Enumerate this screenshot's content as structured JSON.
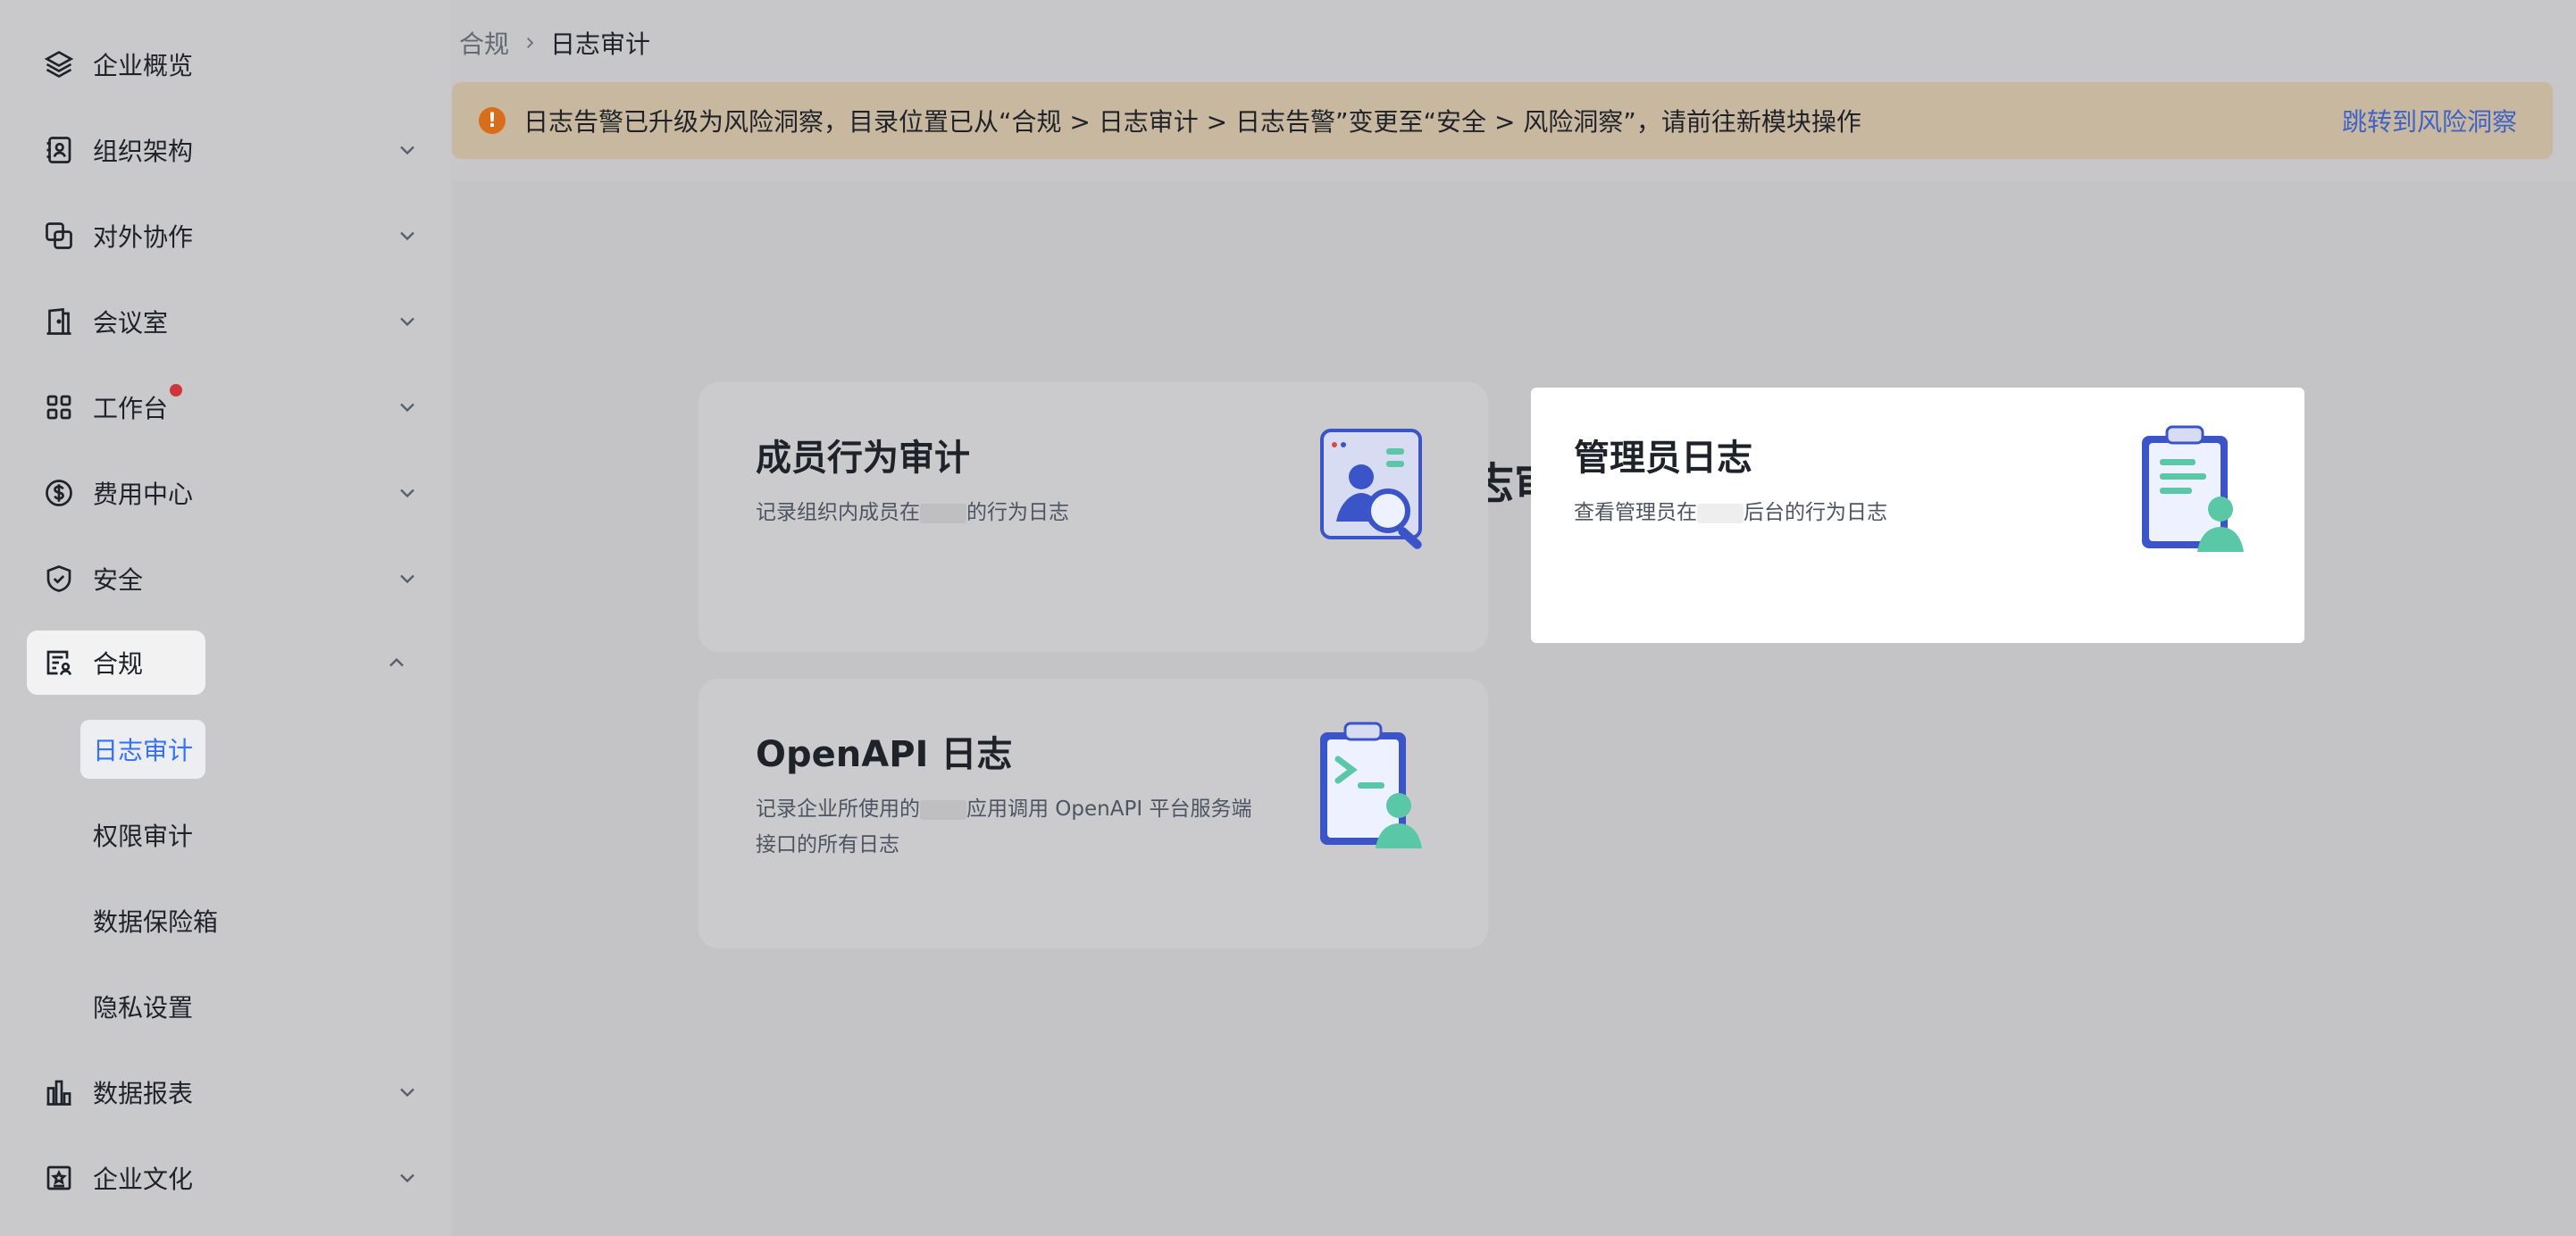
{
  "sidebar": {
    "items": [
      {
        "label": "企业概览",
        "icon": "layers-icon",
        "has_chevron": false
      },
      {
        "label": "组织架构",
        "icon": "contact-book-icon",
        "has_chevron": true
      },
      {
        "label": "对外协作",
        "icon": "link-squares-icon",
        "has_chevron": true
      },
      {
        "label": "会议室",
        "icon": "door-icon",
        "has_chevron": true
      },
      {
        "label": "工作台",
        "icon": "grid-icon",
        "has_chevron": true,
        "badge": true
      },
      {
        "label": "费用中心",
        "icon": "dollar-icon",
        "has_chevron": true
      },
      {
        "label": "安全",
        "icon": "shield-icon",
        "has_chevron": true
      },
      {
        "label": "合规",
        "icon": "compliance-icon",
        "has_chevron": true,
        "expanded": true
      },
      {
        "label": "数据报表",
        "icon": "bar-chart-icon",
        "has_chevron": true
      },
      {
        "label": "企业文化",
        "icon": "culture-icon",
        "has_chevron": true
      }
    ],
    "sub_items": [
      {
        "label": "日志审计",
        "active": true
      },
      {
        "label": "权限审计",
        "active": false
      },
      {
        "label": "数据保险箱",
        "active": false
      },
      {
        "label": "隐私设置",
        "active": false
      }
    ]
  },
  "breadcrumb": {
    "parent": "合规",
    "current": "日志审计"
  },
  "notice": {
    "text": "日志告警已升级为风险洞察，目录位置已从“合规 > 日志审计 > 日志告警”变更至“安全 > 风险洞察”，请前往新模块操作",
    "link": "跳转到风险洞察"
  },
  "main": {
    "title": "日志审计",
    "cards": [
      {
        "title": "成员行为审计",
        "desc_before": "记录组织内成员在",
        "desc_after": "的行为日志",
        "icon": "member-audit-icon"
      },
      {
        "title": "管理员日志",
        "desc_before": "查看管理员在",
        "desc_after": "后台的行为日志",
        "icon": "admin-log-icon"
      },
      {
        "title": "OpenAPI 日志",
        "desc_before": "记录企业所使用的",
        "desc_after": "应用调用 OpenAPI 平台服务端接口的所有日志",
        "icon": "openapi-log-icon"
      }
    ]
  },
  "colors": {
    "accent": "#3370ff",
    "link": "#3f62c7",
    "warning": "#d86d1c",
    "badge": "#d0353c"
  }
}
